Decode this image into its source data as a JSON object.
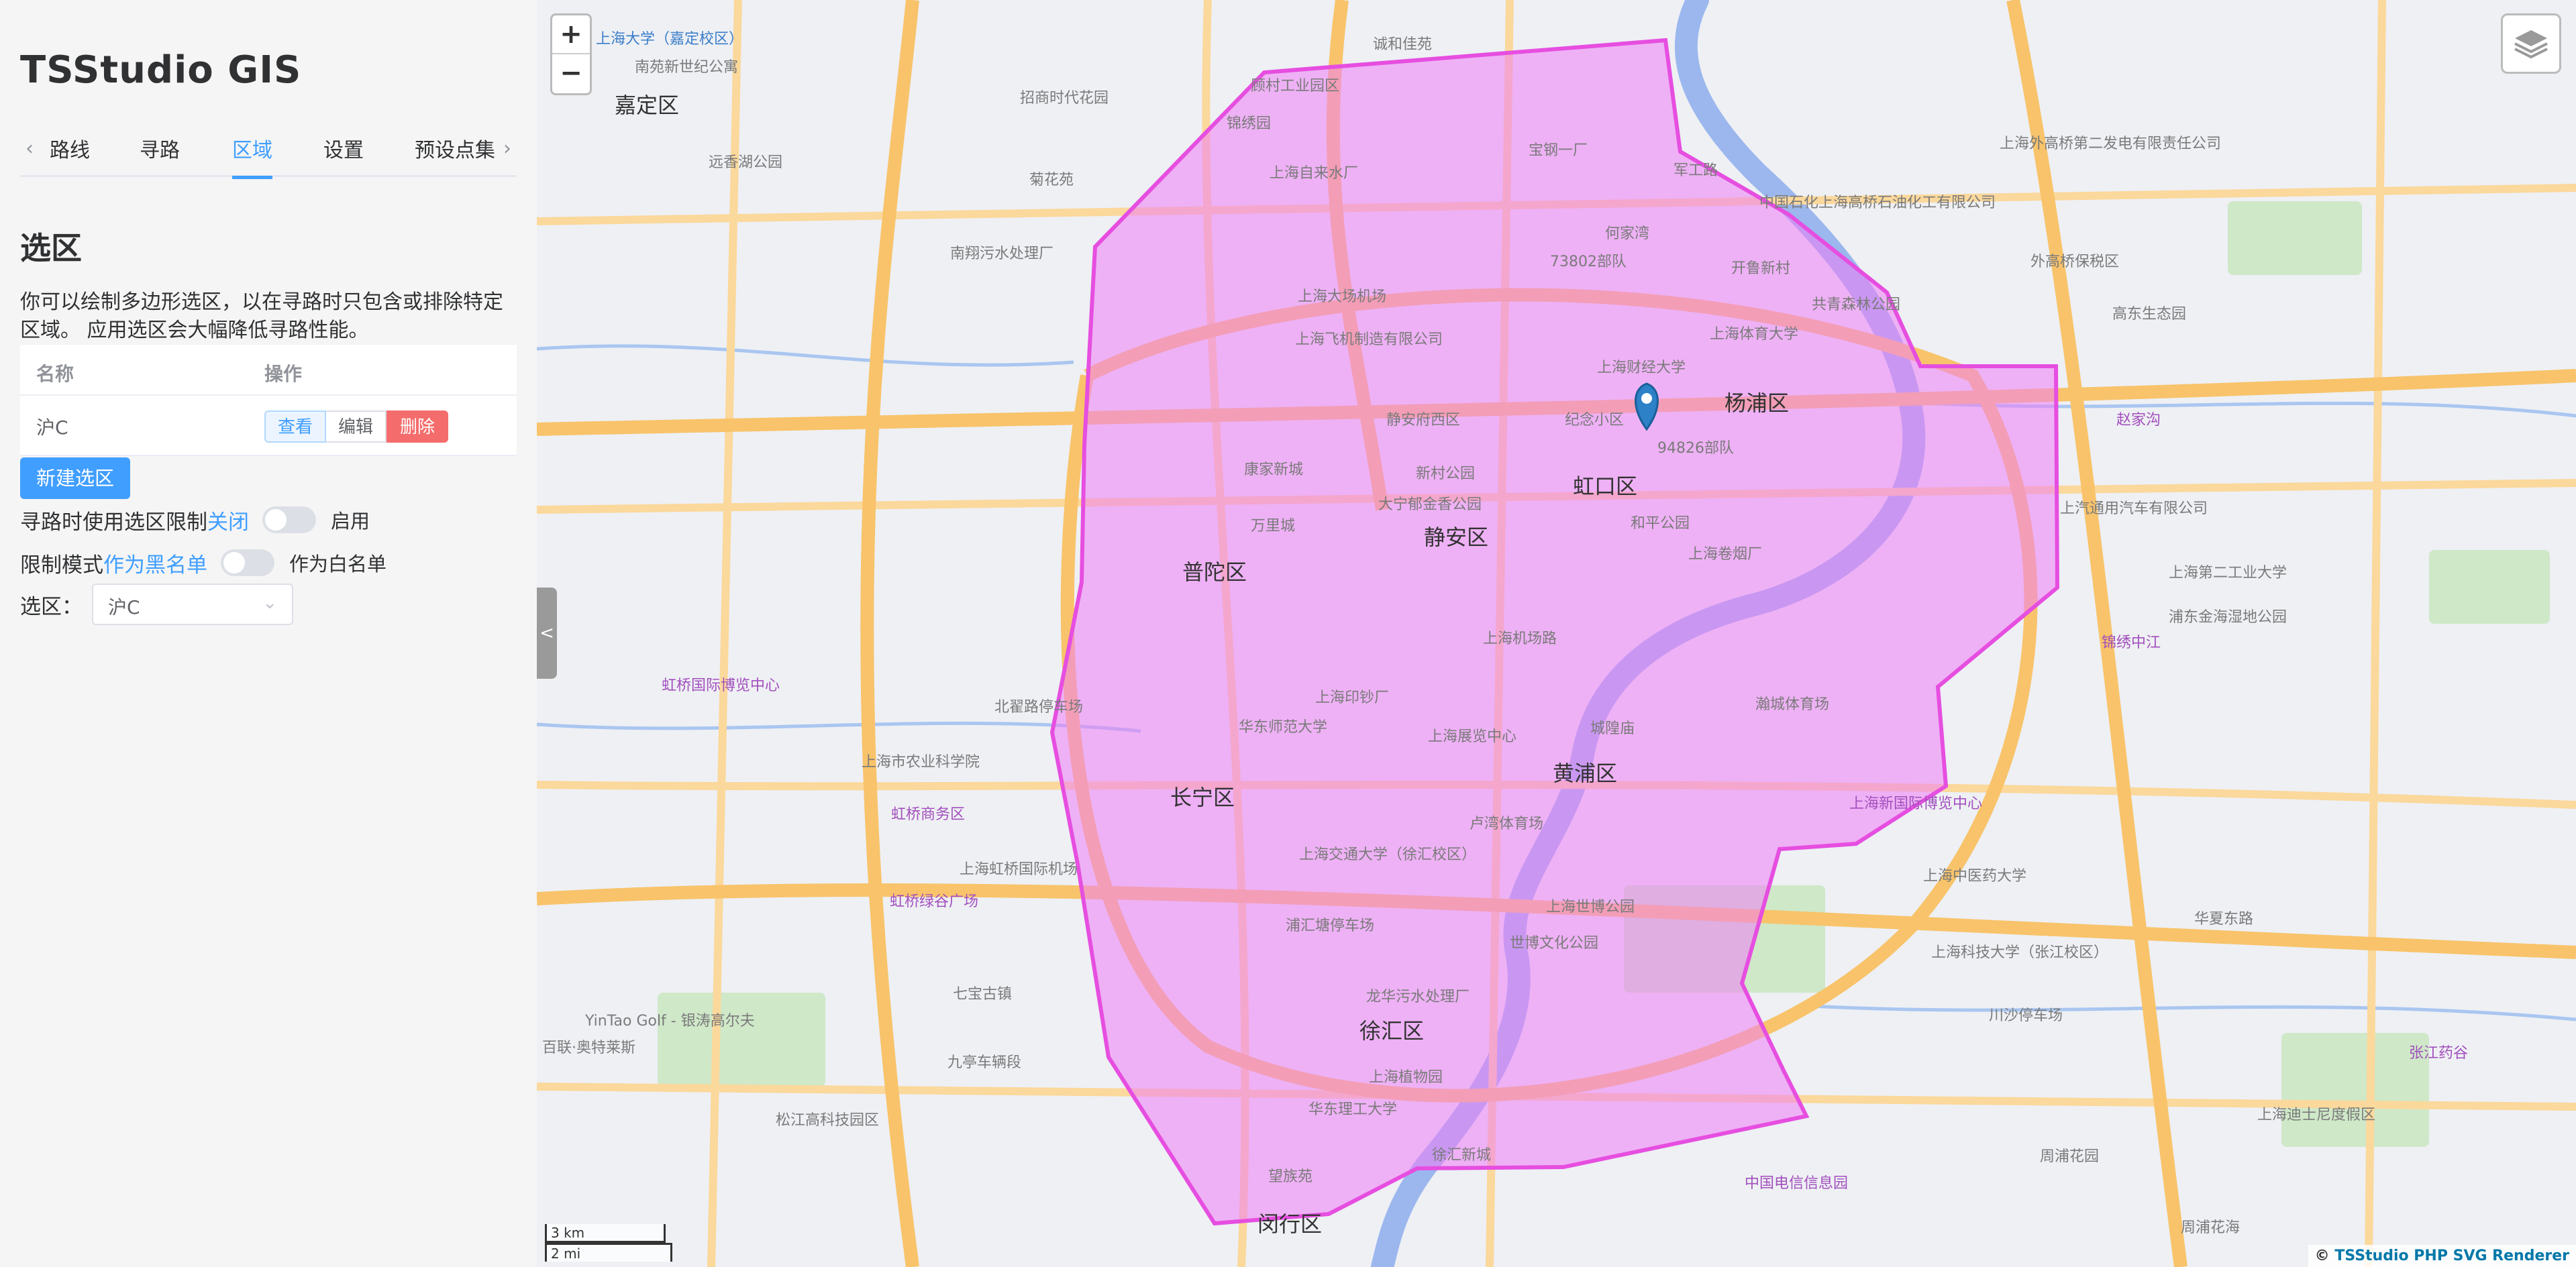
{
  "app": {
    "title": "TSStudio GIS"
  },
  "tabs": [
    {
      "label": "路线",
      "active": false
    },
    {
      "label": "寻路",
      "active": false
    },
    {
      "label": "区域",
      "active": true
    },
    {
      "label": "设置",
      "active": false
    },
    {
      "label": "预设点集",
      "active": false
    }
  ],
  "section": {
    "title": "选区",
    "description": "你可以绘制多边形选区，以在寻路时只包含或排除特定区域。 应用选区会大幅降低寻路性能。"
  },
  "table": {
    "headers": {
      "name": "名称",
      "action": "操作"
    },
    "rows": [
      {
        "name": "沪C",
        "view": "查看",
        "edit": "编辑",
        "delete": "删除"
      }
    ]
  },
  "new_region_button": "新建选区",
  "options": {
    "limit": {
      "label": "寻路时使用选区限制",
      "off_label": "关闭",
      "on_label": "启用",
      "enabled": false
    },
    "mode": {
      "label": "限制模式",
      "off_label": "作为黑名单",
      "on_label": "作为白名单",
      "whitelist": false
    },
    "region_select": {
      "label": "选区：",
      "value": "沪C"
    }
  },
  "map": {
    "zoom_in": "+",
    "zoom_out": "−",
    "collapse": "<",
    "scale_km": "3 km",
    "scale_mi": "2 mi",
    "attribution_prefix": "© ",
    "attribution_name": "TSStudio PHP SVG Renderer",
    "colors": {
      "polygon_fill": "#ef7ef5",
      "polygon_stroke": "#e64ee0",
      "river": "#9bb7ee",
      "highway": "#f8c36a",
      "arterial": "#fbd89b",
      "marker": "#2c81c7"
    },
    "district_labels": [
      "嘉定区",
      "虹口区",
      "杨浦区",
      "静安区",
      "普陀区",
      "长宁区",
      "黄浦区",
      "徐汇区",
      "闵行区"
    ],
    "place_labels": [
      "上海大学（嘉定校区）",
      "南苑新世纪公寓",
      "诚和佳苑",
      "顾村工业园区",
      "锦绣园",
      "招商时代花园",
      "菊花苑",
      "远香湖公园",
      "南翔污水处理厂",
      "上海自来水厂",
      "宝钢一厂",
      "军工路",
      "何家湾",
      "73802部队",
      "开鲁新村",
      "上海大场机场",
      "上海飞机制造有限公司",
      "上海财经大学",
      "上海体育大学",
      "共青森林公园",
      "静安府西区",
      "纪念小区",
      "94826部队",
      "和平公园",
      "大宁郁金香公园",
      "新村公园",
      "万里城",
      "康家新城",
      "上海卷烟厂",
      "上海机场路",
      "上海印钞厂",
      "华东师范大学",
      "上海展览中心",
      "城隍庙",
      "瀚城体育场",
      "上海交通大学（徐汇校区）",
      "卢湾体育场",
      "上海世博公园",
      "世博文化公园",
      "浦汇塘停车场",
      "龙华污水处理厂",
      "上海植物园",
      "华东理工大学",
      "徐汇新城",
      "望族苑",
      "上海新国际博览中心",
      "上海外高桥第二发电有限责任公司",
      "中国石化上海高桥石油化工有限公司",
      "外高桥保税区",
      "高东生态园",
      "赵家沟",
      "上汽通用汽车有限公司",
      "上海第二工业大学",
      "锦绣中江",
      "浦东金海湿地公园",
      "上海科技大学（张江校区）",
      "上海迪士尼度假区",
      "川沙停车场",
      "华夏东路",
      "张江药谷",
      "周浦花海",
      "虹桥商务区",
      "虹桥国际博览中心",
      "上海虹桥国际机场",
      "虹桥绿谷广场",
      "七宝古镇",
      "上海市农业科学院",
      "北翟路停车场",
      "九亭车辆段",
      "松江高科技园区",
      "YinTao Golf - 银涛高尔夫",
      "百联·奥特莱斯",
      "上海中医药大学",
      "中国电信信息园",
      "周浦花园"
    ]
  }
}
